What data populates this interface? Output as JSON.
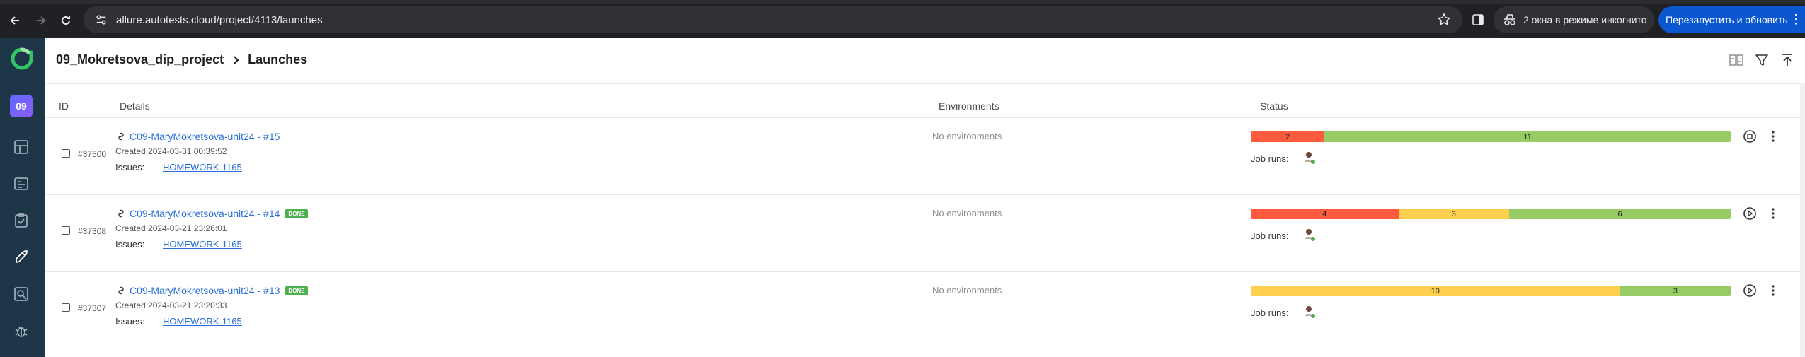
{
  "browser": {
    "url": "allure.autotests.cloud/project/4113/launches",
    "incognito_label": "2 окна в режиме инкогнито",
    "relaunch_label": "Перезапустить и обновить"
  },
  "sidebar": {
    "project_badge": "09",
    "items": [
      "dashboards-icon",
      "test-cases-icon",
      "test-plans-icon",
      "launches-icon",
      "analytics-icon",
      "defects-icon"
    ]
  },
  "header": {
    "project_name": "09_Mokretsova_dip_project",
    "page_name": "Launches"
  },
  "table": {
    "columns": {
      "id": "ID",
      "details": "Details",
      "environments": "Environments",
      "status": "Status"
    },
    "rows": [
      {
        "id": "#37500",
        "title": "C09-MaryMokretsova-unit24 - #15",
        "done_badge": "",
        "created": "Created 2024-03-31 00:39:52",
        "issues_label": "Issues:",
        "issue": "HOMEWORK-1165",
        "environment": "No environments",
        "status": {
          "failed": "2",
          "broken": "",
          "passed": "11",
          "failed_n": 2,
          "broken_n": 0,
          "passed_n": 11
        },
        "job_runs_label": "Job runs:",
        "action_icon": "stop-icon"
      },
      {
        "id": "#37308",
        "title": "C09-MaryMokretsova-unit24 - #14",
        "done_badge": "DONE",
        "created": "Created 2024-03-21 23:26:01",
        "issues_label": "Issues:",
        "issue": "HOMEWORK-1165",
        "environment": "No environments",
        "status": {
          "failed": "4",
          "broken": "3",
          "passed": "6",
          "failed_n": 4,
          "broken_n": 3,
          "passed_n": 6
        },
        "job_runs_label": "Job runs:",
        "action_icon": "rerun-icon"
      },
      {
        "id": "#37307",
        "title": "C09-MaryMokretsova-unit24 - #13",
        "done_badge": "DONE",
        "created": "Created 2024-03-21 23:20:33",
        "issues_label": "Issues:",
        "issue": "HOMEWORK-1165",
        "environment": "No environments",
        "status": {
          "failed": "",
          "broken": "10",
          "passed": "3",
          "failed_n": 0,
          "broken_n": 10,
          "passed_n": 3
        },
        "job_runs_label": "Job runs:",
        "action_icon": "rerun-icon"
      }
    ]
  },
  "colors": {
    "failed": "#fd5a3e",
    "broken": "#ffd050",
    "passed": "#97cc64",
    "sidebar": "#1d3749",
    "link": "#2a6fd8"
  }
}
